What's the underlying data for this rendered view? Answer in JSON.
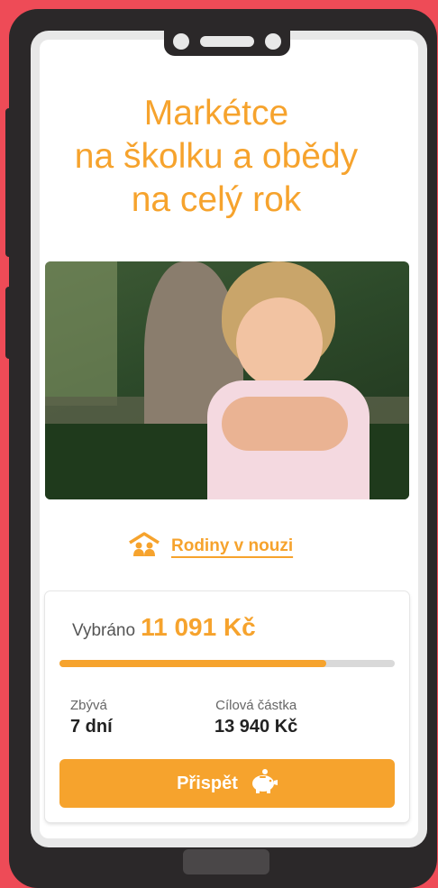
{
  "campaign": {
    "title_lines": [
      "Markétce",
      "na školku a obědy",
      "na celý rok"
    ],
    "category": {
      "label": "Rodiny v nouzi",
      "icon": "family-house-icon"
    }
  },
  "funding": {
    "raised_label": "Vybráno",
    "raised_amount": "11 091 Kč",
    "progress": 0.7956,
    "remaining_label": "Zbývá",
    "remaining_value": "7 dní",
    "target_label": "Cílová částka",
    "target_value": "13 940 Kč",
    "donate_label": "Přispět",
    "donate_icon": "piggy-bank-icon"
  },
  "colors": {
    "accent": "#f6a32d",
    "background": "#ee4b57",
    "device": "#2b2829"
  }
}
